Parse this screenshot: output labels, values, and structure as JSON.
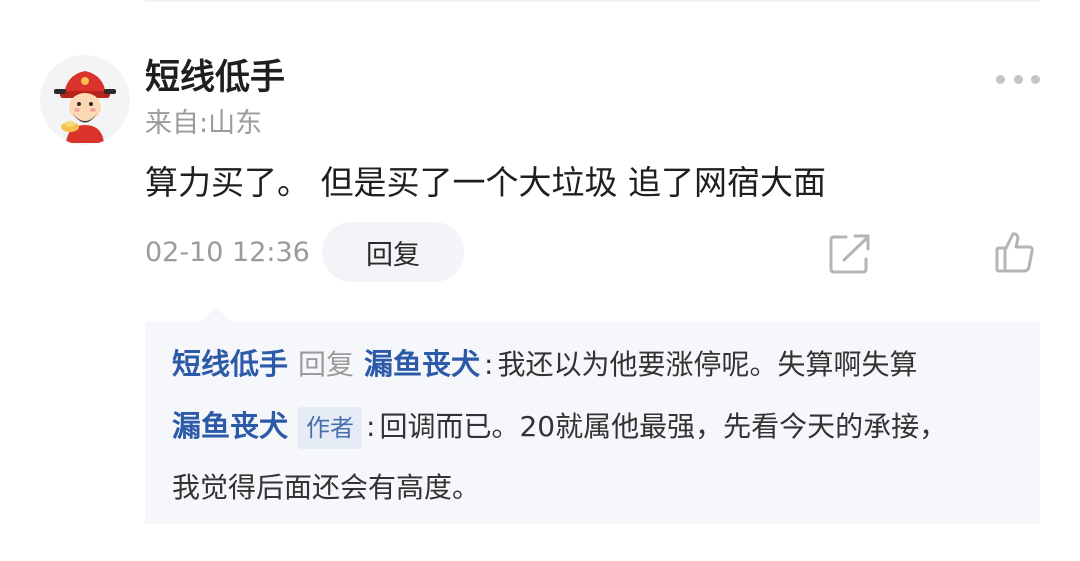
{
  "comment": {
    "username": "短线低手",
    "location": "来自:山东",
    "text": "算力买了。 但是买了一个大垃圾 追了网宿大面",
    "timestamp": "02-10 12:36",
    "reply_label": "回复",
    "icons": {
      "avatar": "caishen-avatar",
      "more": "more-dots-icon",
      "share": "share-icon",
      "like": "thumbs-up-icon"
    }
  },
  "replies": [
    {
      "from": "短线低手",
      "verb": "回复",
      "to": "漏鱼丧犬",
      "colon": ":",
      "text": "我还以为他要涨停呢。失算啊失算"
    },
    {
      "from": "漏鱼丧犬",
      "badge": "作者",
      "colon": ":",
      "text_line1": "回调而已。20就属他最强，先看今天的承接，",
      "text_line2": "我觉得后面还会有高度。"
    }
  ],
  "colors": {
    "name_blue": "#2d5aa8",
    "reply_bg": "#f5f7fa",
    "muted_gray": "#9b9b9b"
  }
}
